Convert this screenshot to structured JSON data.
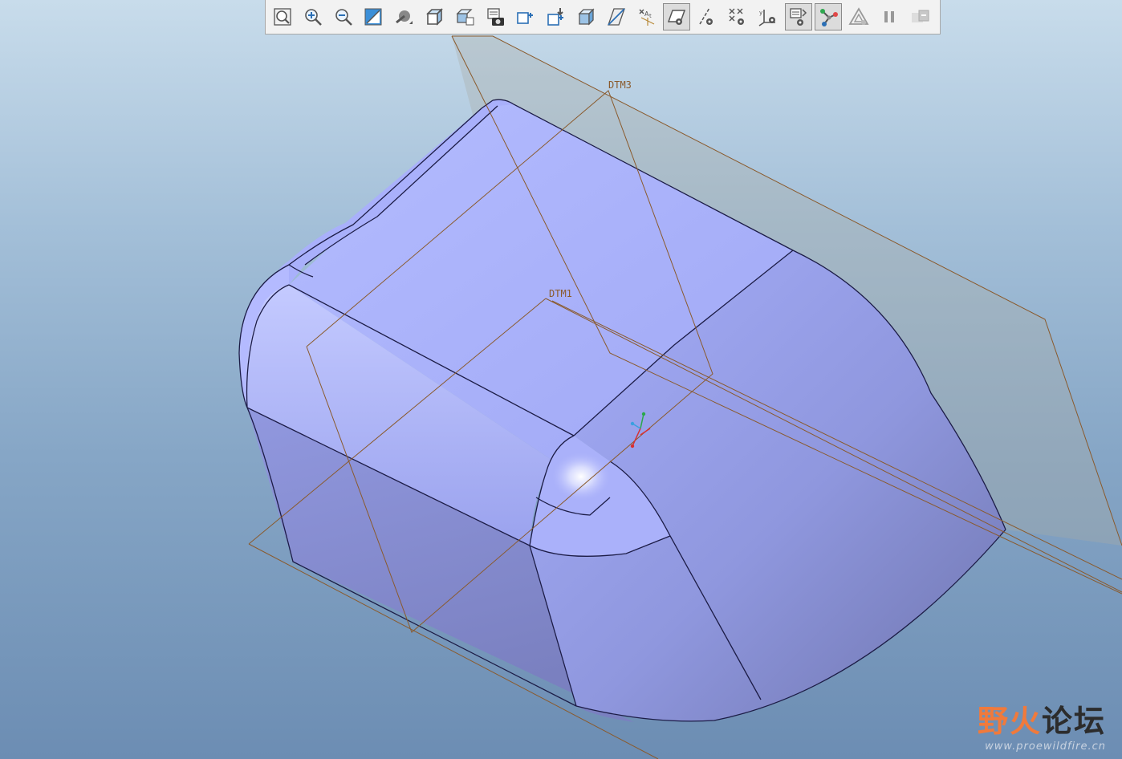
{
  "toolbar": {
    "buttons": [
      {
        "name": "refit",
        "icon": "zoom-fit-icon",
        "active": false
      },
      {
        "name": "zoom-in",
        "icon": "zoom-in-icon",
        "active": false
      },
      {
        "name": "zoom-out",
        "icon": "zoom-out-icon",
        "active": false
      },
      {
        "name": "repaint",
        "icon": "repaint-icon",
        "active": false
      },
      {
        "name": "display-style",
        "icon": "shading-icon",
        "active": false
      },
      {
        "name": "saved-views",
        "icon": "view-cube-icon",
        "active": false
      },
      {
        "name": "view-manager",
        "icon": "view-manager-icon",
        "active": false
      },
      {
        "name": "render",
        "icon": "render-camera-icon",
        "active": false
      },
      {
        "name": "spin-center",
        "icon": "spin-center-icon",
        "active": false
      },
      {
        "name": "orient-mode",
        "icon": "orient-icon",
        "active": false
      },
      {
        "name": "perspective",
        "icon": "perspective-icon",
        "active": false
      },
      {
        "name": "section",
        "icon": "section-icon",
        "active": false
      },
      {
        "name": "annotation-display",
        "icon": "annotation-icon",
        "active": false
      },
      {
        "name": "plane-display",
        "icon": "datum-plane-icon",
        "active": true
      },
      {
        "name": "axis-display",
        "icon": "datum-axis-icon",
        "active": false
      },
      {
        "name": "point-display",
        "icon": "datum-point-icon",
        "active": false
      },
      {
        "name": "csys-display",
        "icon": "csys-icon",
        "active": false
      },
      {
        "name": "spin-center-display",
        "icon": "spin-center-display-icon",
        "active": true
      },
      {
        "name": "tangent-edges",
        "icon": "curve-network-icon",
        "active": true
      },
      {
        "name": "shade-toggle",
        "icon": "triangle-mesh-icon",
        "active": false
      },
      {
        "name": "pause",
        "icon": "pause-icon",
        "active": false
      },
      {
        "name": "next",
        "icon": "next-icon",
        "active": false
      }
    ]
  },
  "datums": {
    "dtm3": "DTM3",
    "dtm1": "DTM1"
  },
  "colors": {
    "part_light": "#a9b2fb",
    "part_mid": "#8f98e0",
    "part_dark": "#7077b4",
    "edge": "#1c1c46",
    "datum_plane": "#8a5a2c",
    "toolbar_icon": "#2b6fb5"
  },
  "watermark": {
    "part1": "野火",
    "part2": "论坛",
    "url": "www.proewildfire.cn"
  }
}
